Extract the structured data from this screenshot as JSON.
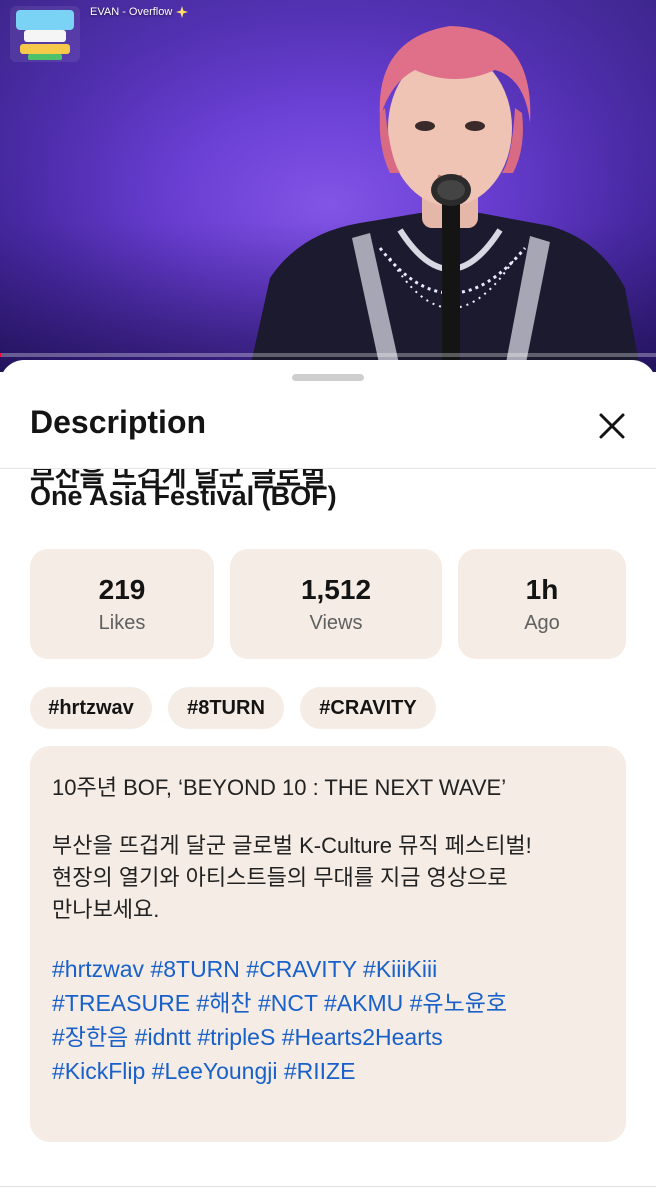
{
  "video": {
    "now_playing": "EVAN - Overflow",
    "progress_fraction": 0.002
  },
  "sheet": {
    "title": "Description",
    "cut_off_line": "부산을 뜨겁게 달군 글로벌",
    "video_title": "One Asia Festival (BOF)"
  },
  "stats": [
    {
      "value": "219",
      "label": "Likes"
    },
    {
      "value": "1,512",
      "label": "Views"
    },
    {
      "value": "1h",
      "label": "Ago"
    }
  ],
  "tags": [
    "#hrtzwav",
    "#8TURN",
    "#CRAVITY"
  ],
  "description": {
    "line1": "10주년 BOF, ‘BEYOND 10 : THE NEXT WAVE’",
    "para": [
      "부산을 뜨겁게 달군 글로벌 K-Culture 뮤직 페스티벌!",
      "현장의 열기와 아티스트들의 무대를 지금 영상으로",
      "만나보세요."
    ],
    "hashtags": [
      [
        "#hrtzwav",
        "#8TURN",
        "#CRAVITY",
        "#KiiiKiii"
      ],
      [
        "#TREASURE",
        "#해찬",
        "#NCT",
        "#AKMU",
        "#유노윤호"
      ],
      [
        "#장한음",
        "#idntt",
        "#tripleS",
        "#Hearts2Hearts"
      ],
      [
        "#KickFlip",
        "#LeeYoungji",
        "#RIIZE"
      ]
    ]
  },
  "colors": {
    "card_bg": "#f4ece5",
    "hashtag": "#1960c9",
    "progress": "#ff0033",
    "stage_light": "#6b3fd6"
  },
  "icons": {
    "close": "close-icon",
    "logo": "festival-logo",
    "sparkle": "sparkle-icon"
  }
}
